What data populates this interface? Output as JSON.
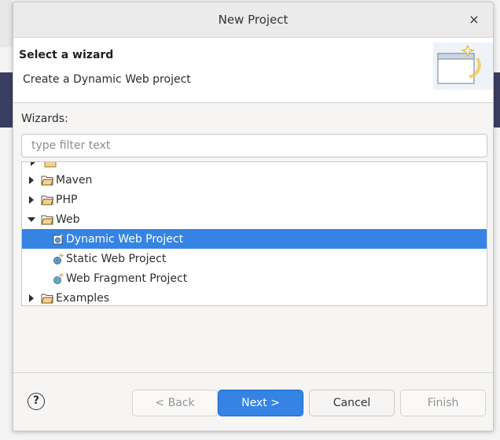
{
  "window": {
    "title": "New Project",
    "close_symbol": "×"
  },
  "banner": {
    "title": "Select a wizard",
    "description": "Create a Dynamic Web project",
    "icon": "wizard-window-sparkle-icon"
  },
  "wizards": {
    "label": "Wizards:",
    "filter_placeholder": "type filter text",
    "filter_value": "",
    "tree": [
      {
        "label": "Maven",
        "kind": "folder",
        "state": "collapsed",
        "depth": 0
      },
      {
        "label": "PHP",
        "kind": "folder",
        "state": "collapsed",
        "depth": 0
      },
      {
        "label": "Web",
        "kind": "folder",
        "state": "expanded",
        "depth": 0
      },
      {
        "label": "Dynamic Web Project",
        "kind": "item",
        "depth": 1,
        "selected": true
      },
      {
        "label": "Static Web Project",
        "kind": "item",
        "depth": 1
      },
      {
        "label": "Web Fragment Project",
        "kind": "item",
        "depth": 1
      },
      {
        "label": "Examples",
        "kind": "folder",
        "state": "collapsed",
        "depth": 0
      }
    ]
  },
  "buttons": {
    "help": "?",
    "back": "< Back",
    "next": "Next >",
    "cancel": "Cancel",
    "finish": "Finish"
  },
  "colors": {
    "selection": "#3584e4",
    "folder": "#e8c477",
    "background_dark": "#3a3f61"
  }
}
